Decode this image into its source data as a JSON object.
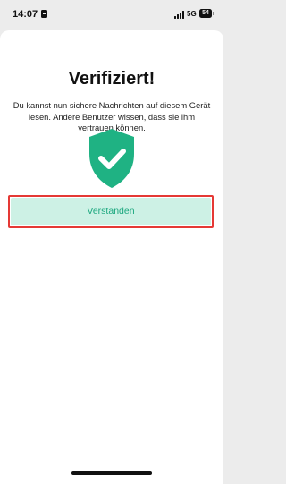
{
  "status_bar": {
    "time": "14:07",
    "network": "5G",
    "battery": "54"
  },
  "dialog": {
    "title": "Verifiziert!",
    "description": "Du kannst nun sichere Nachrichten auf diesem Gerät lesen. Andere Benutzer wissen, dass sie ihm vertrauen können.",
    "icon": "shield-check-icon",
    "confirm_label": "Verstanden"
  },
  "colors": {
    "accent": "#1fb283",
    "button_bg": "#cdf1e5",
    "highlight": "#e53935"
  }
}
